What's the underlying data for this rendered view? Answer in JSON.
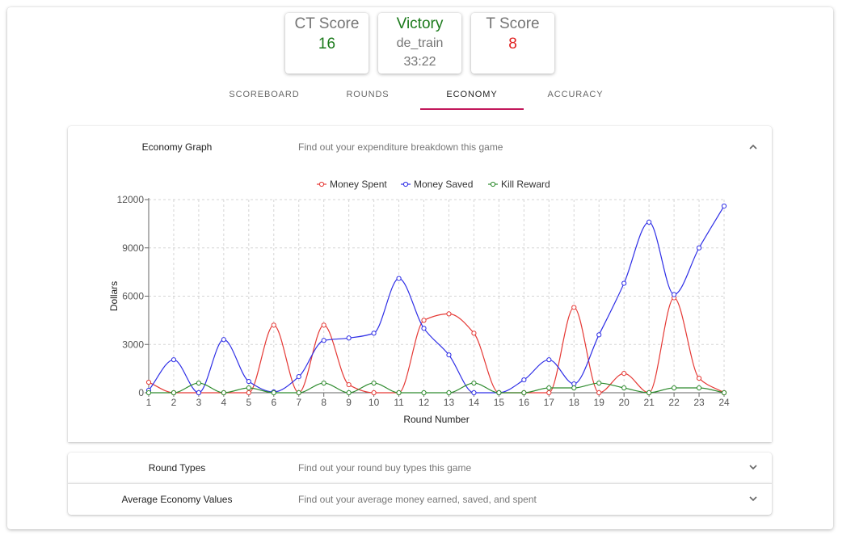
{
  "scoreboard": {
    "ct_label": "CT Score",
    "ct_score": "16",
    "result": "Victory",
    "map": "de_train",
    "duration": "33:22",
    "t_label": "T Score",
    "t_score": "8",
    "colors": {
      "ct": "#1b7a1b",
      "victory": "#1b7a1b",
      "t": "#e02020"
    }
  },
  "tabs": [
    {
      "label": "SCOREBOARD",
      "active": false
    },
    {
      "label": "ROUNDS",
      "active": false
    },
    {
      "label": "ECONOMY",
      "active": true
    },
    {
      "label": "ACCURACY",
      "active": false
    }
  ],
  "panels": {
    "economy_graph": {
      "title": "Economy Graph",
      "description": "Find out your expenditure breakdown this game",
      "expanded": true,
      "icon": "chevron-up-icon"
    },
    "round_types": {
      "title": "Round Types",
      "description": "Find out your round buy types this game",
      "expanded": false,
      "icon": "chevron-down-icon"
    },
    "avg_economy": {
      "title": "Average Economy Values",
      "description": "Find out your average money earned, saved, and spent",
      "expanded": false,
      "icon": "chevron-down-icon"
    }
  },
  "chart_data": {
    "type": "line",
    "xlabel": "Round Number",
    "ylabel": "Dollars",
    "ylim": [
      0,
      12000
    ],
    "yticks": [
      0,
      3000,
      6000,
      9000,
      12000
    ],
    "x": [
      1,
      2,
      3,
      4,
      5,
      6,
      7,
      8,
      9,
      10,
      11,
      12,
      13,
      14,
      15,
      16,
      17,
      18,
      19,
      20,
      21,
      22,
      23,
      24
    ],
    "grid": true,
    "legend": "top-center",
    "series": [
      {
        "name": "Money Spent",
        "color": "#e53935",
        "values": [
          650,
          0,
          0,
          0,
          0,
          4200,
          0,
          4200,
          500,
          0,
          0,
          4500,
          4900,
          3700,
          0,
          0,
          0,
          5300,
          0,
          1200,
          0,
          5900,
          900,
          0
        ]
      },
      {
        "name": "Money Saved",
        "color": "#2e2ee6",
        "values": [
          150,
          2050,
          0,
          3300,
          700,
          50,
          1000,
          3250,
          3400,
          3700,
          7100,
          4000,
          2350,
          0,
          0,
          800,
          2050,
          550,
          3600,
          6800,
          10600,
          6100,
          9000,
          11600
        ]
      },
      {
        "name": "Kill Reward",
        "color": "#2e8b2e",
        "values": [
          0,
          0,
          600,
          0,
          300,
          0,
          0,
          600,
          0,
          600,
          0,
          0,
          0,
          600,
          0,
          0,
          300,
          300,
          600,
          300,
          0,
          300,
          300,
          0
        ]
      }
    ]
  }
}
